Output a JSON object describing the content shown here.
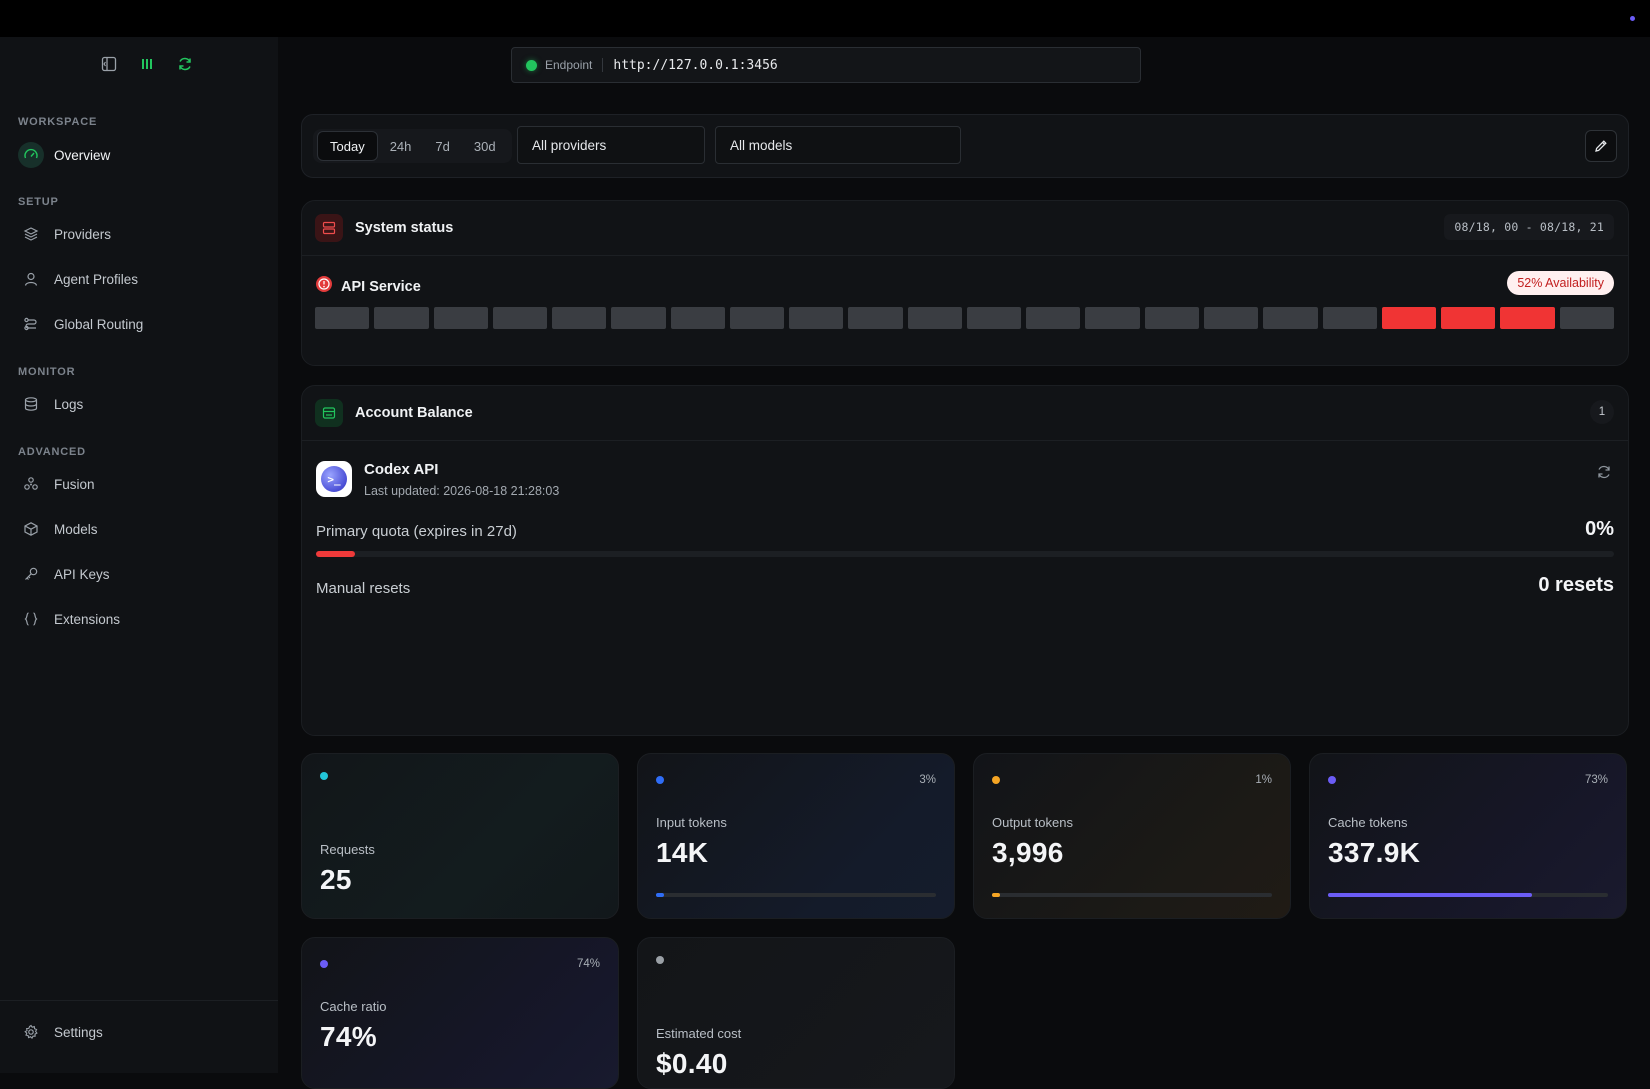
{
  "sidebar": {
    "sections": [
      {
        "title": "WORKSPACE",
        "items": [
          {
            "label": "Overview",
            "icon": "gauge-icon",
            "active": true
          }
        ]
      },
      {
        "title": "SETUP",
        "items": [
          {
            "label": "Providers",
            "icon": "layers-icon"
          },
          {
            "label": "Agent Profiles",
            "icon": "user-icon"
          },
          {
            "label": "Global Routing",
            "icon": "routing-icon"
          }
        ]
      },
      {
        "title": "MONITOR",
        "items": [
          {
            "label": "Logs",
            "icon": "database-icon"
          }
        ]
      },
      {
        "title": "ADVANCED",
        "items": [
          {
            "label": "Fusion",
            "icon": "fusion-icon"
          },
          {
            "label": "Models",
            "icon": "cube-icon"
          },
          {
            "label": "API Keys",
            "icon": "key-icon"
          },
          {
            "label": "Extensions",
            "icon": "braces-icon"
          }
        ]
      }
    ],
    "settings_label": "Settings"
  },
  "endpoint": {
    "label": "Endpoint",
    "url": "http://127.0.0.1:3456",
    "status_color": "#22c55e"
  },
  "filters": {
    "ranges": [
      "Today",
      "24h",
      "7d",
      "30d"
    ],
    "selected_range": "Today",
    "provider": "All providers",
    "model": "All models"
  },
  "system_status": {
    "title": "System status",
    "date_range": "08/18, 00 - 08/18, 21",
    "service": "API Service",
    "availability": "52% Availability",
    "buckets": [
      "up",
      "up",
      "up",
      "up",
      "up",
      "up",
      "up",
      "up",
      "up",
      "up",
      "up",
      "up",
      "up",
      "up",
      "up",
      "up",
      "up",
      "up",
      "down",
      "down",
      "down",
      "up"
    ]
  },
  "account_balance": {
    "title": "Account Balance",
    "count": "1",
    "account_name": "Codex API",
    "last_updated": "Last updated: 2026-08-18 21:28:03",
    "quota_label": "Primary quota (expires in 27d)",
    "quota_pct": "0%",
    "quota_fill": 0.03,
    "resets_label": "Manual resets",
    "resets_value": "0 resets"
  },
  "stats": {
    "requests": {
      "label": "Requests",
      "value": "25",
      "dot_color": "#22c5d8"
    },
    "input_tokens": {
      "label": "Input tokens",
      "value": "14K",
      "pct": "3%",
      "fill": 0.03,
      "dot_color": "#2f6df6"
    },
    "output_tokens": {
      "label": "Output tokens",
      "value": "3,996",
      "pct": "1%",
      "fill": 0.01,
      "dot_color": "#f5a524"
    },
    "cache_tokens": {
      "label": "Cache tokens",
      "value": "337.9K",
      "pct": "73%",
      "fill": 0.73,
      "dot_color": "#6b5cf6"
    },
    "cache_ratio": {
      "label": "Cache ratio",
      "value": "74%",
      "pct": "74%",
      "dot_color": "#6b5cf6"
    },
    "estimated_cost": {
      "label": "Estimated cost",
      "value": "$0.40",
      "dot_color": "#9aa0a6"
    }
  },
  "colors": {
    "accent_green": "#22c55e",
    "alert_red": "#f03434",
    "purple": "#6b5cf6"
  }
}
